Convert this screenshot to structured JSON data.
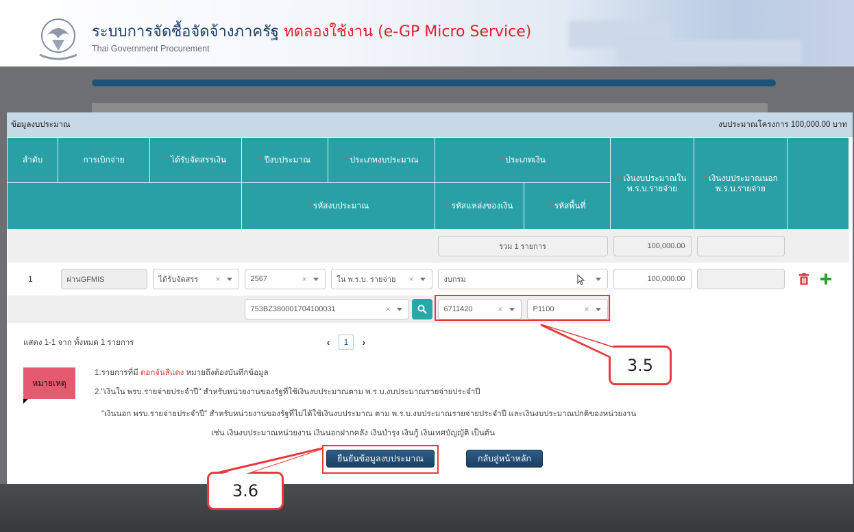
{
  "header": {
    "title_main": "ระบบการจัดซื้อจัดจ้างภาครัฐ",
    "title_trial": "ทดลองใช้งาน (e-GP Micro Service)",
    "subtitle": "Thai Government Procurement"
  },
  "modal": {
    "title": "ข้อมูลงบประมาณ",
    "project_budget": "งบประมาณโครงการ 100,000.00 บาท"
  },
  "table": {
    "headers": {
      "seq": "ลำดับ",
      "disbursement": "การเบิกจ่าย",
      "allocated": "ได้รับจัดสรรเงิน",
      "fiscal_year": "ปีงบประมาณ",
      "budget_type": "ประเภทงบประมาณ",
      "money_type": "ประเภทเงิน",
      "budget_in": "เงินงบประมาณใน พ.ร.บ.รายจ่าย",
      "budget_out": "เงินงบประมาณนอก พ.ร.บ.รายจ่าย",
      "budget_code": "รหัสงบประมาณ",
      "fund_source_code": "รหัสแหล่งของเงิน",
      "area_code": "รหัสพื้นที่"
    },
    "summary": {
      "total_label": "รวม 1 รายการ",
      "total_in": "100,000.00",
      "total_out": ""
    },
    "rows": [
      {
        "seq": "1",
        "disbursement": "ผ่านGFMIS",
        "allocated": "ได้รับจัดสรร",
        "fiscal_year": "2567",
        "budget_type": "ใน พ.ร.บ. รายจ่าย",
        "money_type": "งบกรม",
        "budget_in": "100,000.00",
        "budget_out": "",
        "budget_code": "753BZ380001704100031",
        "fund_source_code": "6711420",
        "area_code": "P1100"
      }
    ]
  },
  "pagination": {
    "info": "แสดง 1-1 จาก ทั้งหมด 1 รายการ",
    "prev": "‹",
    "current": "1",
    "next": "›"
  },
  "notes": {
    "tag": "หมายเหตุ",
    "line1_a": "1.รายการที่มี",
    "line1_red": "ดอกจันสีแดง",
    "line1_b": "หมายถึงต้องบันทึกข้อมูล",
    "line2": "2.\"เงินใน พรบ.รายจ่ายประจำปี\" สำหรับหน่วยงานของรัฐที่ใช้เงินงบประมาณตาม พ.ร.บ.งบประมาณรายจ่ายประจำปี",
    "line3": "\"เงินนอก พรบ.รายจ่ายประจำปี\" สำหรับหน่วยงานของรัฐที่ไม่ได้ใช้เงินงบประมาณ ตาม พ.ร.บ.งบประมาณรายจ่ายประจำปี และเงินงบประมาณปกติของหน่วยงาน",
    "line4": "เช่น เงินงบประมาณหน่วยงาน เงินนอกฝากคลัง เงินบำรุง เงินกู้ เงินเทศบัญญัติ เป็นต้น"
  },
  "buttons": {
    "confirm": "ยืนยันข้อมูลงบประมาณ",
    "back": "กลับสู่หน้าหลัก"
  },
  "callouts": {
    "c1": "3.5",
    "c2": "3.6"
  },
  "icons": {
    "delete": "trash-icon",
    "add": "plus-icon",
    "search": "search-icon"
  },
  "colors": {
    "table_header": "#29a0a6",
    "highlight": "#e8383d",
    "button": "#1f4a72",
    "add_icon": "#2aa32a",
    "delete_icon": "#d9363e"
  }
}
